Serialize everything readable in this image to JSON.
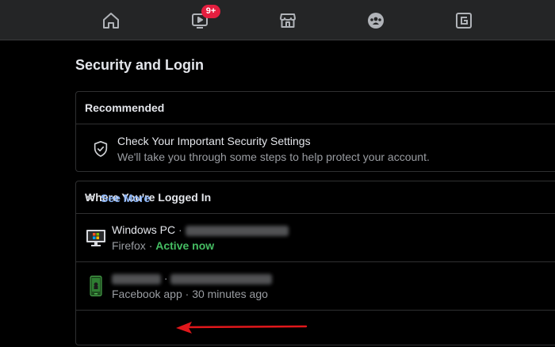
{
  "nav": {
    "items": [
      {
        "icon": "home-icon"
      },
      {
        "icon": "watch-icon",
        "badge": "9+"
      },
      {
        "icon": "marketplace-icon"
      },
      {
        "icon": "groups-icon"
      },
      {
        "icon": "gaming-icon"
      }
    ]
  },
  "page": {
    "title": "Security and Login"
  },
  "recommended": {
    "header": "Recommended",
    "item_title": "Check Your Important Security Settings",
    "item_subtitle": "We'll take you through some steps to help protect your account."
  },
  "logged_in": {
    "header": "Where You're Logged In",
    "sessions": [
      {
        "device": "Windows PC",
        "separator": "·",
        "app": "Firefox",
        "status": "Active now"
      },
      {
        "separator": "·",
        "app": "Facebook app",
        "time": "30 minutes ago"
      }
    ],
    "see_more": "See More"
  },
  "colors": {
    "nav_bg": "#242526",
    "badge": "#e41e3f",
    "active_status": "#45bd62",
    "link": "#8ab4f8",
    "annotation_arrow": "#e0171b"
  }
}
